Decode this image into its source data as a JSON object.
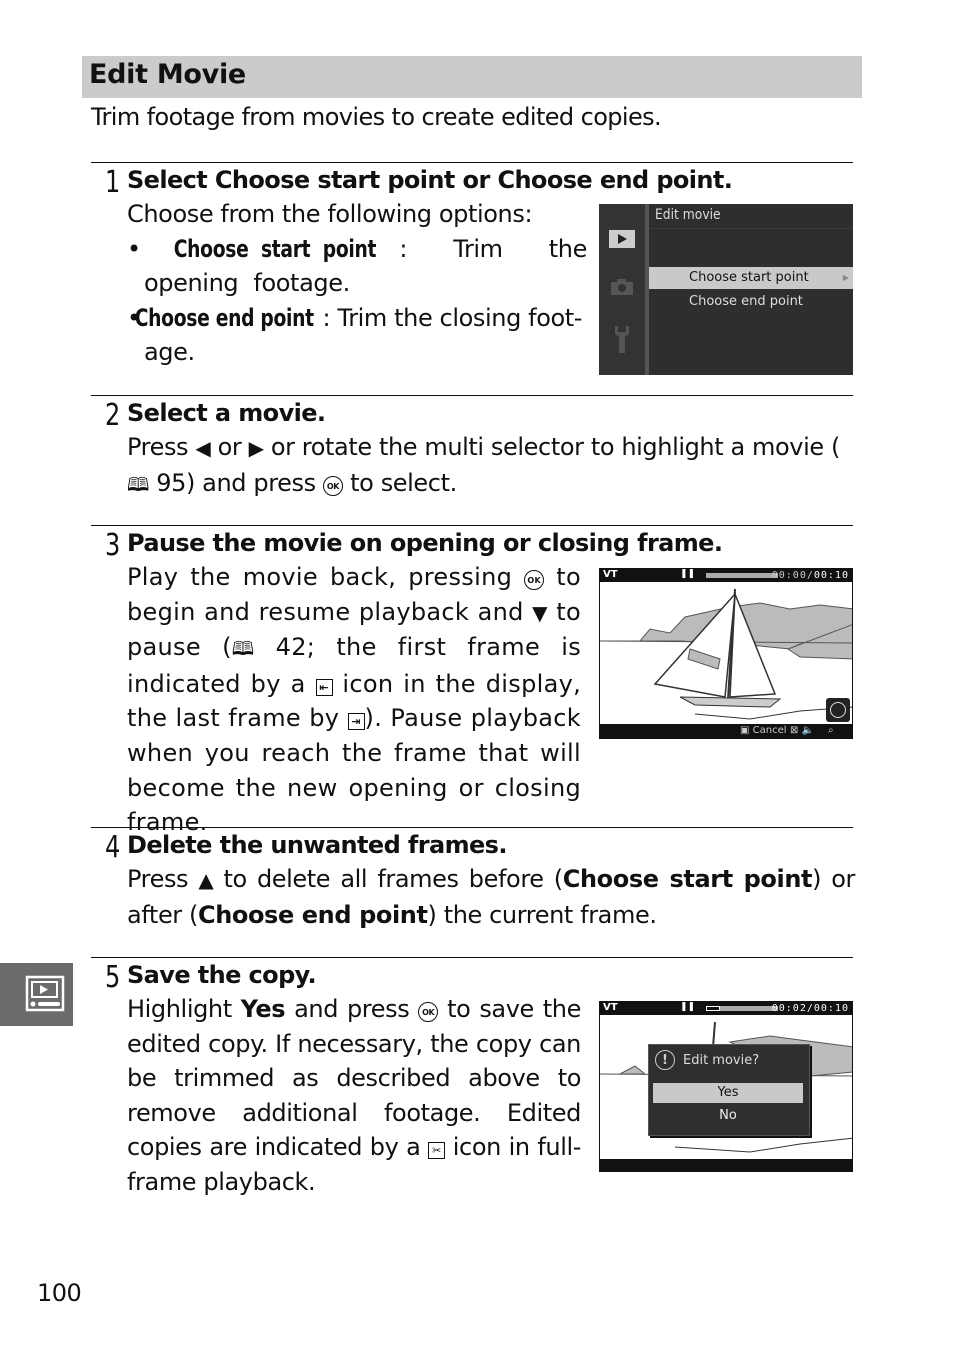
{
  "section": {
    "title": "Edit Movie",
    "intro": "Trim footage from movies to create edited copies.",
    "side_tab_icon": "playback-menu-icon",
    "page_number": "100"
  },
  "steps": [
    {
      "number": "1",
      "heading_parts": [
        "Select ",
        "Choose start point",
        " or ",
        "Choose end point",
        "."
      ],
      "body_lead": "Choose from the following options:",
      "bullets": [
        {
          "term": "Choose start point",
          "text": ": Trim the opening footage."
        },
        {
          "term": "Choose end point",
          "text": ": Trim the closing foot-age."
        }
      ],
      "screen": {
        "title": "Edit movie",
        "menu_items": [
          {
            "label": "Choose start point",
            "selected": true
          },
          {
            "label": "Choose end point",
            "selected": false
          }
        ],
        "sidebar_icons": [
          "playback-icon",
          "camera-icon",
          "wrench-icon"
        ]
      }
    },
    {
      "number": "2",
      "heading": "Select a movie.",
      "body": {
        "t1": "Press ",
        "left": "◀",
        "t2": " or ",
        "right": "▶",
        "t3": " or rotate the multi selector to highlight a movie (",
        "book": "🕮",
        "t4": " 95) and press ",
        "ok": "OK",
        "t5": " to select."
      }
    },
    {
      "number": "3",
      "heading": "Pause the movie on opening or closing frame.",
      "body": {
        "t1": "Play the movie back, pressing ",
        "ok": "OK",
        "t2": " to begin and resume playback and ",
        "down": "▼",
        "t3": " to pause (",
        "book": "🕮",
        "t4": " 42; the first frame is indicated by a ",
        "first_icon": "⇤",
        "t5": " icon in the display, the last frame by ",
        "last_icon": "⇥",
        "t6": "). Pause playback when you reach the frame that will become the new opening or closing frame."
      },
      "screen": {
        "time_current": "00:00",
        "time_total": "00:10",
        "progress": 0.0,
        "bottom_labels": {
          "cancel": "Cancel"
        }
      }
    },
    {
      "number": "4",
      "heading": "Delete the unwanted frames.",
      "body": {
        "t1": "Press ",
        "up": "▲",
        "t2": " to delete all frames before (",
        "b1": "Choose start point",
        "t3": ") or after (",
        "b2": "Choose end point",
        "t4": ") the current frame."
      }
    },
    {
      "number": "5",
      "heading": "Save the copy.",
      "body": {
        "t1": "Highlight ",
        "b1": "Yes",
        "t2": " and press ",
        "ok": "OK",
        "t3": " to save the edited copy. If necessary, the copy can be trimmed as described above to remove additional footage. Edited copies are indicated by a ",
        "edit_icon": "✂",
        "t4": " icon in full-frame playback."
      },
      "screen": {
        "time_current": "00:02",
        "time_total": "00:10",
        "progress": 0.2,
        "dialog_title": "Edit movie?",
        "options": [
          {
            "label": "Yes",
            "selected": true
          },
          {
            "label": "No",
            "selected": false
          }
        ]
      }
    }
  ]
}
